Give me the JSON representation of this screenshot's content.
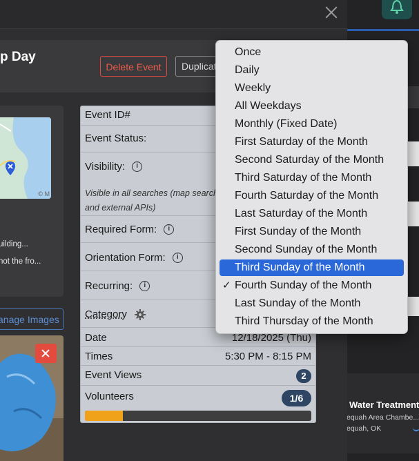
{
  "modal": {
    "title": "p Day",
    "delete_label": "Delete Event",
    "duplicate_label": "Duplicat",
    "close_icon": "close-icon"
  },
  "location": {
    "address_line1": "uilding...",
    "address_line2": "not the fro...",
    "map_attribution": "© M",
    "manage_images_label": "anage Images"
  },
  "details": {
    "event_id_label": "Event ID#",
    "event_status_label": "Event Status:",
    "visibility_label": "Visibility:",
    "visibility_note": "Visible in all searches (map search and external APIs)",
    "required_form_label": "Required Form:",
    "orientation_form_label": "Orientation Form:",
    "recurring_label": "Recurring:",
    "category_label": "Category",
    "date_label": "Date",
    "date_value": "12/18/2025 (Thu)",
    "times_label": "Times",
    "times_value": "5:30 PM - 8:15 PM",
    "views_label": "Event Views",
    "views_value": "2",
    "volunteers_label": "Volunteers",
    "volunteers_value": "1/6",
    "volunteers_fraction": 0.1667,
    "info_icon_glyph": "i",
    "gear_icon": "gear-icon"
  },
  "recurring_menu": {
    "items": [
      "Once",
      "Daily",
      "Weekly",
      "All Weekdays",
      "Monthly (Fixed Date)",
      "First Saturday of the Month",
      "Second Saturday of the Month",
      "Third Saturday of the Month",
      "Fourth Saturday of the Month",
      "Last Saturday of the Month",
      "First Sunday of the Month",
      "Second Sunday of the Month",
      "Third Sunday of the Month",
      "Fourth Sunday of the Month",
      "Last Sunday of the Month",
      "Third Thursday of the Month"
    ],
    "highlighted": "Third Sunday of the Month",
    "checked": "Fourth Sunday of the Month",
    "check_glyph": "✓"
  },
  "background": {
    "card_title": "Water Treatment",
    "card_org": "equah Area Chambe...",
    "card_location": "equah, OK",
    "bell_icon": "bell-icon"
  },
  "colors": {
    "accent_blue": "#2a67d8",
    "danger": "#e04a3f",
    "progress": "#f0a21b",
    "badge": "#2e4664"
  }
}
